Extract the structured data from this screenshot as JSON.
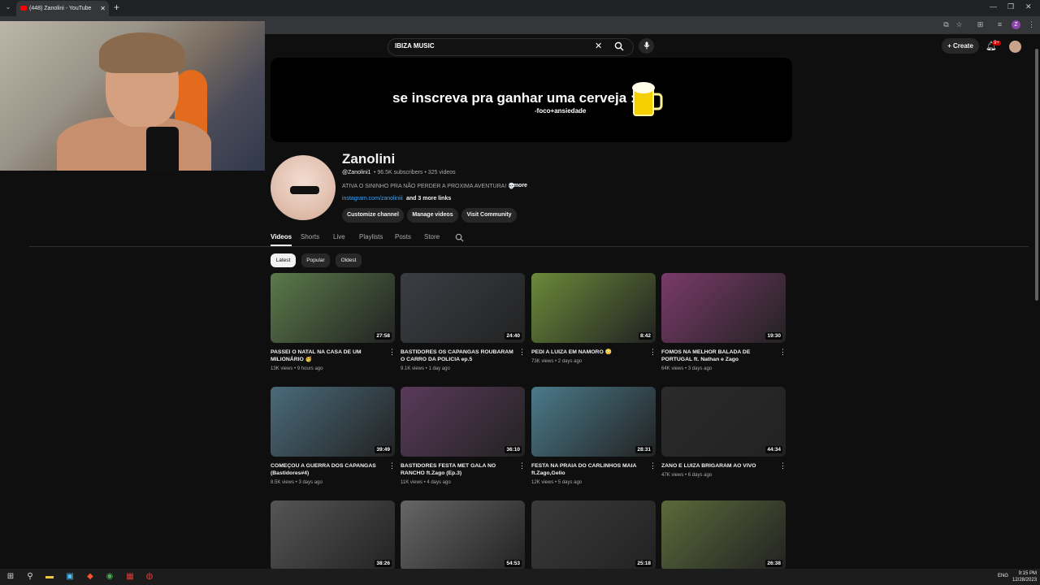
{
  "browser": {
    "tab_title": "(448) Zanolini - YouTube",
    "close_glyph": "✕",
    "new_tab_glyph": "+",
    "profile_initial": "Z"
  },
  "header": {
    "search_value": "IBIZA MUSIC",
    "clear_glyph": "✕",
    "create_label": "+ Create",
    "notification_count": "9+"
  },
  "banner": {
    "text": "se inscreva pra ganhar uma cerveja :)",
    "subtext": "-foco+ansiedade"
  },
  "channel": {
    "name": "Zanolini",
    "handle": "@Zanolini1",
    "meta": "• 96.5K subscribers • 325 videos",
    "description": "ATIVA O SININHO PRA NÃO PERDER A PROXIMA AVENTURA! 💀",
    "more": "...more",
    "link": "instagram.com/zanoliniii",
    "links_more": "and 3 more links",
    "buttons": [
      "Customize channel",
      "Manage videos",
      "Visit Community"
    ]
  },
  "tabs": [
    "Videos",
    "Shorts",
    "Live",
    "Playlists",
    "Posts",
    "Store"
  ],
  "filters": [
    "Latest",
    "Popular",
    "Oldest"
  ],
  "videos": [
    {
      "title": "PASSEI O NATAL NA CASA DE UM MILIONÁRIO 🥳",
      "meta": "13K views • 9 hours ago",
      "duration": "27:58",
      "color": "#5a7a4a"
    },
    {
      "title": "BASTIDORES OS CAPANGAS ROUBARAM O CARRO DA POLICIA ep.5",
      "meta": "9.1K views • 1 day ago",
      "duration": "24:40",
      "color": "#3a3e44"
    },
    {
      "title": "PEDI A LUIZA EM NAMORO 😳",
      "meta": "73K views • 2 days ago",
      "duration": "8:42",
      "color": "#6a8a3a"
    },
    {
      "title": "FOMOS NA MELHOR BALADA DE PORTUGAL ft. Nathan e Zago",
      "meta": "64K views • 3 days ago",
      "duration": "19:30",
      "color": "#7a3a6a"
    },
    {
      "title": "COMEÇOU A GUERRA DOS CAPANGAS (Bastidores#4)",
      "meta": "8.5K views • 3 days ago",
      "duration": "39:49",
      "color": "#4a6a7a"
    },
    {
      "title": "BASTIDORES FESTA MET GALA NO RANCHO ft.Zago (Ep.3)",
      "meta": "11K views • 4 days ago",
      "duration": "36:10",
      "color": "#5a3a5a"
    },
    {
      "title": "FESTA NA PRAIA DO CARLINHOS MAIA ft.Zago,Gelio",
      "meta": "12K views • 5 days ago",
      "duration": "28:31",
      "color": "#4a7a8a"
    },
    {
      "title": "ZANO E LUIZA BRIGARAM AO VIVO",
      "meta": "47K views • 6 days ago",
      "duration": "44:34",
      "color": "#2a2a2a"
    },
    {
      "title": "",
      "meta": "",
      "duration": "38:26",
      "color": "#555555"
    },
    {
      "title": "",
      "meta": "",
      "duration": "54:53",
      "color": "#666666"
    },
    {
      "title": "",
      "meta": "",
      "duration": "25:18",
      "color": "#3a3a3a"
    },
    {
      "title": "",
      "meta": "",
      "duration": "26:38",
      "color": "#5a6a3a"
    }
  ],
  "taskbar": {
    "time": "9:15 PM",
    "date": "12/28/2023",
    "lang": "ENG"
  }
}
